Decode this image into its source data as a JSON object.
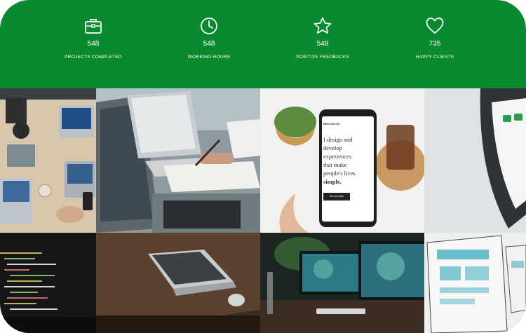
{
  "stats": [
    {
      "icon": "briefcase-icon",
      "value": "548",
      "label": "PROJECTS COMPLETED"
    },
    {
      "icon": "clock-icon",
      "value": "548",
      "label": "WORKING HOURS"
    },
    {
      "icon": "star-icon",
      "value": "548",
      "label": "POSITIVE FEEDBACKS"
    },
    {
      "icon": "heart-icon",
      "value": "735",
      "label": "HAPPY CLIENTS"
    }
  ],
  "phone_screen": {
    "brand": "BEN KELOK",
    "line1": "I design and",
    "line2": "develop",
    "line3": "experiences",
    "line4": "that make",
    "line5": "people's lives",
    "line6": "simple.",
    "button": "See my work"
  },
  "colors": {
    "band": "#0a8a2e",
    "text": "#ffffff"
  }
}
